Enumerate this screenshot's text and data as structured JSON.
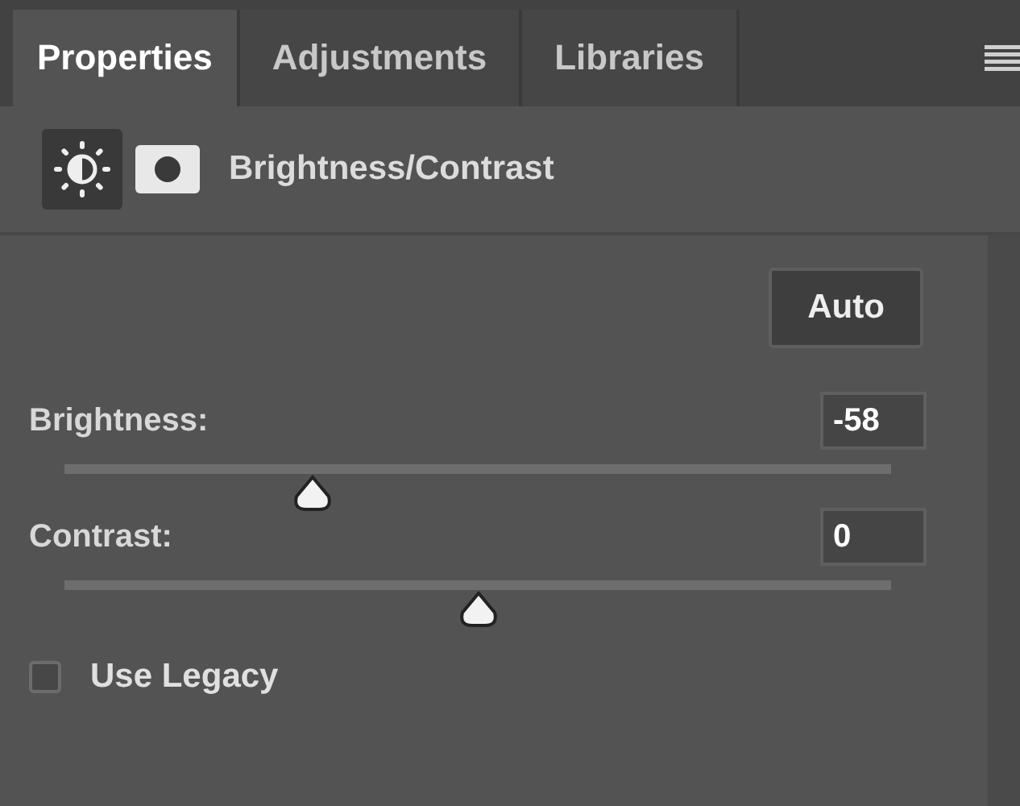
{
  "tabs": [
    {
      "label": "Properties",
      "selected": true
    },
    {
      "label": "Adjustments",
      "selected": false
    },
    {
      "label": "Libraries",
      "selected": false
    }
  ],
  "header": {
    "title": "Brightness/Contrast"
  },
  "auto_button": "Auto",
  "sliders": [
    {
      "label": "Brightness:",
      "value": "-58",
      "level": 0.3
    },
    {
      "label": "Contrast:",
      "value": "0",
      "level": 0.5
    }
  ],
  "use_legacy": {
    "label": "Use Legacy",
    "checked": false
  }
}
